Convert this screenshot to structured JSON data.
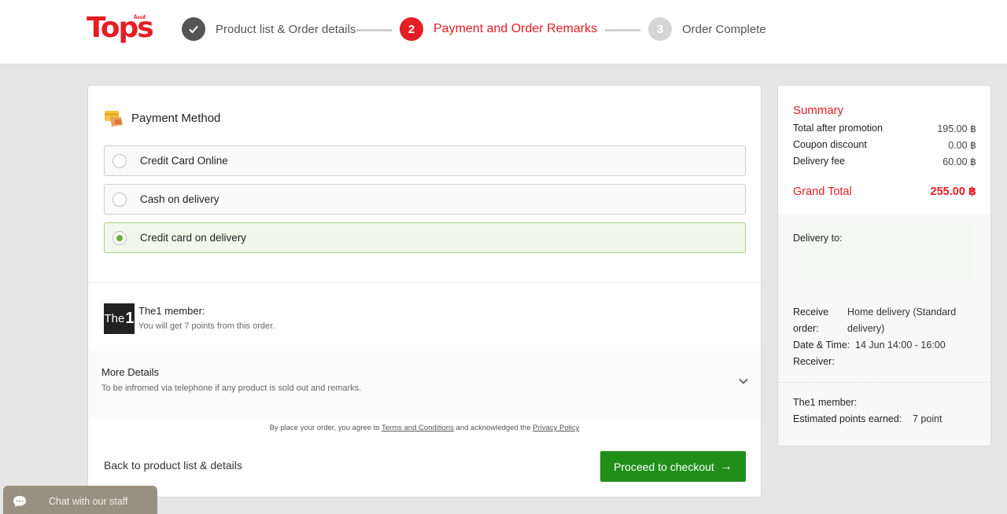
{
  "header": {
    "logo_text": "Tops",
    "logo_small": "ท็อปส์",
    "steps": [
      {
        "number": "✓",
        "label": "Product list & Order details",
        "state": "done"
      },
      {
        "number": "2",
        "label": "Payment and Order Remarks",
        "state": "active"
      },
      {
        "number": "3",
        "label": "Order Complete",
        "state": "pending"
      }
    ]
  },
  "payment": {
    "title": "Payment Method",
    "options": [
      {
        "label": "Credit Card Online",
        "selected": false
      },
      {
        "label": "Cash on delivery",
        "selected": false
      },
      {
        "label": "Credit card on delivery",
        "selected": true
      }
    ]
  },
  "the1": {
    "logo_text": "The",
    "logo_num": "1",
    "title": "The1 member:",
    "subtitle": "You will get 7 points from this order."
  },
  "more_details": {
    "title": "More Details",
    "subtitle": "To be infromed via telephone if any product is sold out and remarks."
  },
  "terms": {
    "prefix": "By place your order, you agree to",
    "terms_link": "Terms and Conditions",
    "middle": "and acknowledged the",
    "privacy_link": "Privacy Policy"
  },
  "actions": {
    "back_label": "Back to product list & details",
    "checkout_label": "Proceed to checkout",
    "checkout_arrow": "→"
  },
  "summary": {
    "title": "Summary",
    "rows": [
      {
        "label": "Total after promotion",
        "value": "195.00 ฿"
      },
      {
        "label": "Coupon discount",
        "value": "0.00 ฿"
      },
      {
        "label": "Delivery fee",
        "value": "60.00 ฿"
      }
    ],
    "grand_total_label": "Grand Total",
    "grand_total_value": "255.00 ฿",
    "delivery_to_label": "Delivery to:",
    "receive_order_label": "Receive order:",
    "receive_order_value": "Home delivery (Standard delivery)",
    "date_time_label": "Date & Time:",
    "date_time_value": "14 Jun 14:00 - 16:00",
    "receiver_label": "Receiver:",
    "the1_label": "The1 member:",
    "estimated_label": "Estimated points earned:",
    "estimated_value": "7 point"
  },
  "chat": {
    "label": "Chat with our staff"
  },
  "colors": {
    "brand_red": "#e31e24",
    "checkout_green": "#1f8f1a",
    "selected_green": "#6aae2e"
  }
}
